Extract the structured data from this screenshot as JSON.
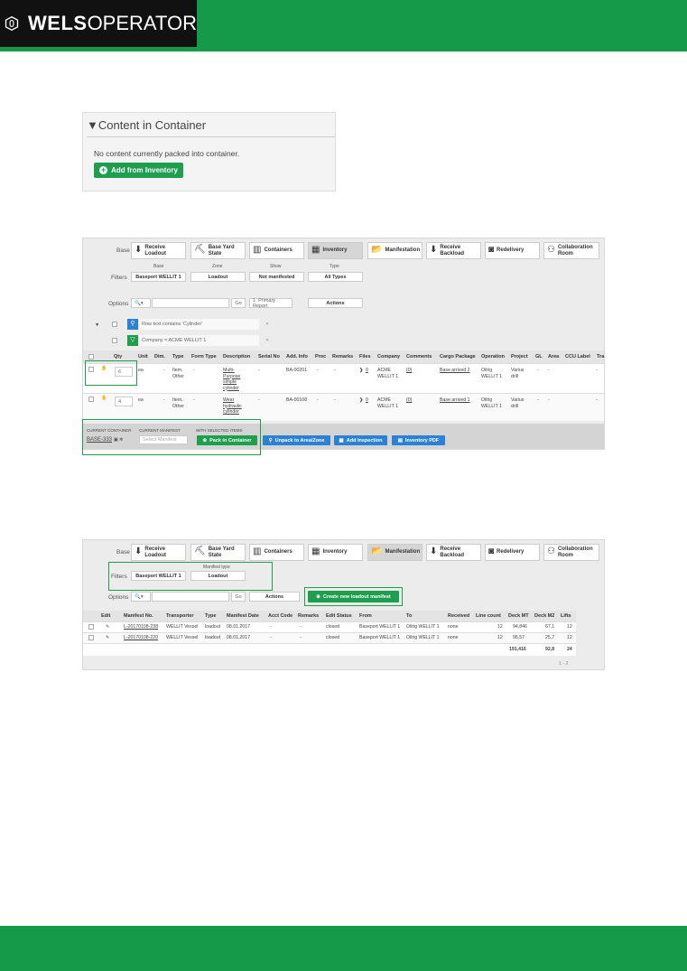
{
  "header": {
    "brand_bold": "WELS",
    "brand_light": "OPERATOR",
    "logo_letter": "O"
  },
  "content_section": {
    "title": "Content in Container",
    "message": "No content currently packed into container.",
    "add_button": "Add from Inventory"
  },
  "nav_tabs": [
    {
      "label": "Receive Loadout",
      "icon": "receive-icon"
    },
    {
      "label": "Base Yard State",
      "icon": "base-yard-icon"
    },
    {
      "label": "Containers",
      "icon": "containers-icon"
    },
    {
      "label": "Inventory",
      "icon": "inventory-icon"
    },
    {
      "label": "Manifestation",
      "icon": "manifest-icon"
    },
    {
      "label": "Receive Backload",
      "icon": "backload-icon"
    },
    {
      "label": "Redelivery",
      "icon": "redelivery-icon"
    },
    {
      "label": "Collaboration Room",
      "icon": "collab-icon"
    }
  ],
  "inventory_panel": {
    "base_label": "Base",
    "filters_label": "Filters",
    "filter_headers": [
      "Base",
      "Zone",
      "Show",
      "Type"
    ],
    "filter_values": [
      "Baseport WELLIT 1",
      "Loadout",
      "Not manifested",
      "All Types"
    ],
    "options_label": "Options",
    "go": "Go",
    "report": "1. Primary Report",
    "actions": "Actions",
    "filter_rows": [
      "Row text contains 'Cylinder'",
      "Company = ACME WELLIT 1"
    ],
    "columns": [
      "Qty",
      "Unit",
      "Dim.",
      "Type",
      "Form Type",
      "Description",
      "Serial No",
      "Add. Info",
      "Proc",
      "Remarks",
      "Files",
      "Company",
      "Comments",
      "Cargo Package",
      "Operation",
      "Project",
      "GL",
      "Area",
      "CCU Label",
      "Tra"
    ],
    "rows": [
      {
        "qty": "6",
        "unit": "ea",
        "dim": "-",
        "type": "Item, Other",
        "form": "-",
        "desc": "Multi-Purpose simple cylinder",
        "serial": "-",
        "info": "BA-00201",
        "proc": "-",
        "remarks": "-",
        "files": "0",
        "company": "ACME WELLIT 1",
        "comments": "(0)",
        "package": "Base arrived 2",
        "operation": "Oilrig WELLIT 1",
        "project": "Varius drill",
        "gl": "-",
        "area": "-",
        "ccu": "-"
      },
      {
        "qty": "4",
        "unit": "ea",
        "dim": "-",
        "type": "Item, Other",
        "form": "-",
        "desc": "Wear hydraulic cylinder",
        "serial": "-",
        "info": "BA-00108",
        "proc": "-",
        "remarks": "-",
        "files": "0",
        "company": "ACME WELLIT 1",
        "comments": "(0)",
        "package": "Base arrived 1",
        "operation": "Oilrig WELLIT 1",
        "project": "Varius drill",
        "gl": "-",
        "area": "-",
        "ccu": "-"
      }
    ],
    "footer": {
      "container_label": "CURRENT CONTAINER",
      "container_value": "BASE-333",
      "manifest_label": "CURRENT MANIFEST",
      "manifest_placeholder": "Select Manifest",
      "selected_label": "WITH SELECTED ITEMS",
      "pack": "Pack in Container",
      "unpack": "Unpack to Area/Zone",
      "inspection": "Add Inspection",
      "pdf": "Inventory PDF"
    }
  },
  "manifest_panel": {
    "base_label": "Base",
    "filters_label": "Filters",
    "manifest_type_label": "Manifest type",
    "filter_values": [
      "Baseport WELLIT 1",
      "Loadout"
    ],
    "options_label": "Options",
    "go": "Go",
    "actions": "Actions",
    "create": "Create new loadout manifest",
    "columns": [
      "Edit",
      "Manifest No.",
      "Transporter",
      "Type",
      "Manifest Date",
      "Acct Code",
      "Remarks",
      "Edit Status",
      "From",
      "To",
      "Received",
      "Line count",
      "Deck MT",
      "Deck M2",
      "Lifts"
    ],
    "rows": [
      {
        "no": "L-20170108-238",
        "transporter": "WELLIT Vessel",
        "type": "loadout",
        "date": "08.01.2017",
        "acct": "-",
        "remarks": "-",
        "status": "closed",
        "from": "Baseport WELLIT 1",
        "to": "Oilrig WELLIT 1",
        "received": "none",
        "lines": "12",
        "mt": "94,846",
        "m2": "67,1",
        "lifts": "12"
      },
      {
        "no": "L-20170108-220",
        "transporter": "WELLIT Vessel",
        "type": "loadout",
        "date": "08.01.2017",
        "acct": "-",
        "remarks": "-",
        "status": "closed",
        "from": "Baseport WELLIT 1",
        "to": "Oilrig WELLIT 1",
        "received": "none",
        "lines": "12",
        "mt": "96,57",
        "m2": "25,7",
        "lifts": "12"
      }
    ],
    "totals": {
      "mt": "191,416",
      "m2": "92,8",
      "lifts": "24"
    },
    "pagination": "1 - 2"
  },
  "colors": {
    "brand_green": "#159a4a",
    "button_green": "#1f9e4e",
    "button_blue": "#2b82d4"
  }
}
